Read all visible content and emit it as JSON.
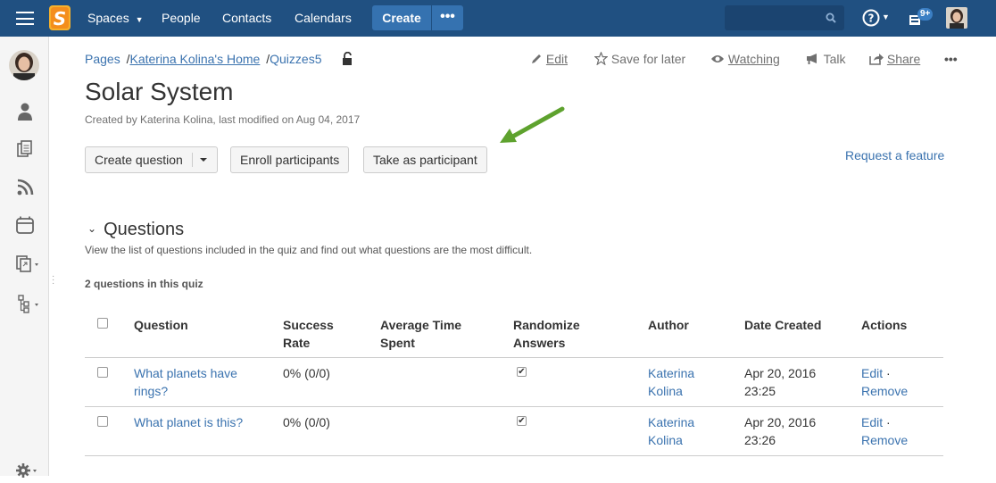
{
  "nav": {
    "spaces": "Spaces",
    "people": "People",
    "contacts": "Contacts",
    "calendars": "Calendars",
    "create": "Create",
    "more": "•••",
    "badge": "9+"
  },
  "breadcrumbs": {
    "pages": "Pages",
    "home": "Katerina Kolina's Home",
    "quizzes": "Quizzes5"
  },
  "actions": {
    "edit": "Edit",
    "save": "Save for later",
    "watching": "Watching",
    "talk": "Talk",
    "share": "Share",
    "more": "•••"
  },
  "page": {
    "title": "Solar System",
    "byline": "Created by Katerina Kolina, last modified on Aug 04, 2017"
  },
  "buttons": {
    "create_question": "Create question",
    "enroll": "Enroll participants",
    "take": "Take as participant",
    "request": "Request a feature"
  },
  "questions": {
    "heading": "Questions",
    "description": "View the list of questions included in the quiz and find out what questions are the most difficult.",
    "count": "2 questions in this quiz",
    "columns": {
      "question": "Question",
      "success1": "Success",
      "success2": "Rate",
      "avg1": "Average Time",
      "avg2": "Spent",
      "rand1": "Randomize",
      "rand2": "Answers",
      "author": "Author",
      "date": "Date Created",
      "actions": "Actions"
    },
    "rows": [
      {
        "q1": "What planets have",
        "q2": "rings?",
        "rate": "0% (0/0)",
        "author1": "Katerina",
        "author2": "Kolina",
        "date1": "Apr 20, 2016",
        "date2": "23:25",
        "edit": "Edit",
        "dot": "·",
        "remove": "Remove"
      },
      {
        "q1": "What planet is this?",
        "q2": "",
        "rate": "0% (0/0)",
        "author1": "Katerina",
        "author2": "Kolina",
        "date1": "Apr 20, 2016",
        "date2": "23:26",
        "edit": "Edit",
        "dot": "·",
        "remove": "Remove"
      }
    ]
  }
}
